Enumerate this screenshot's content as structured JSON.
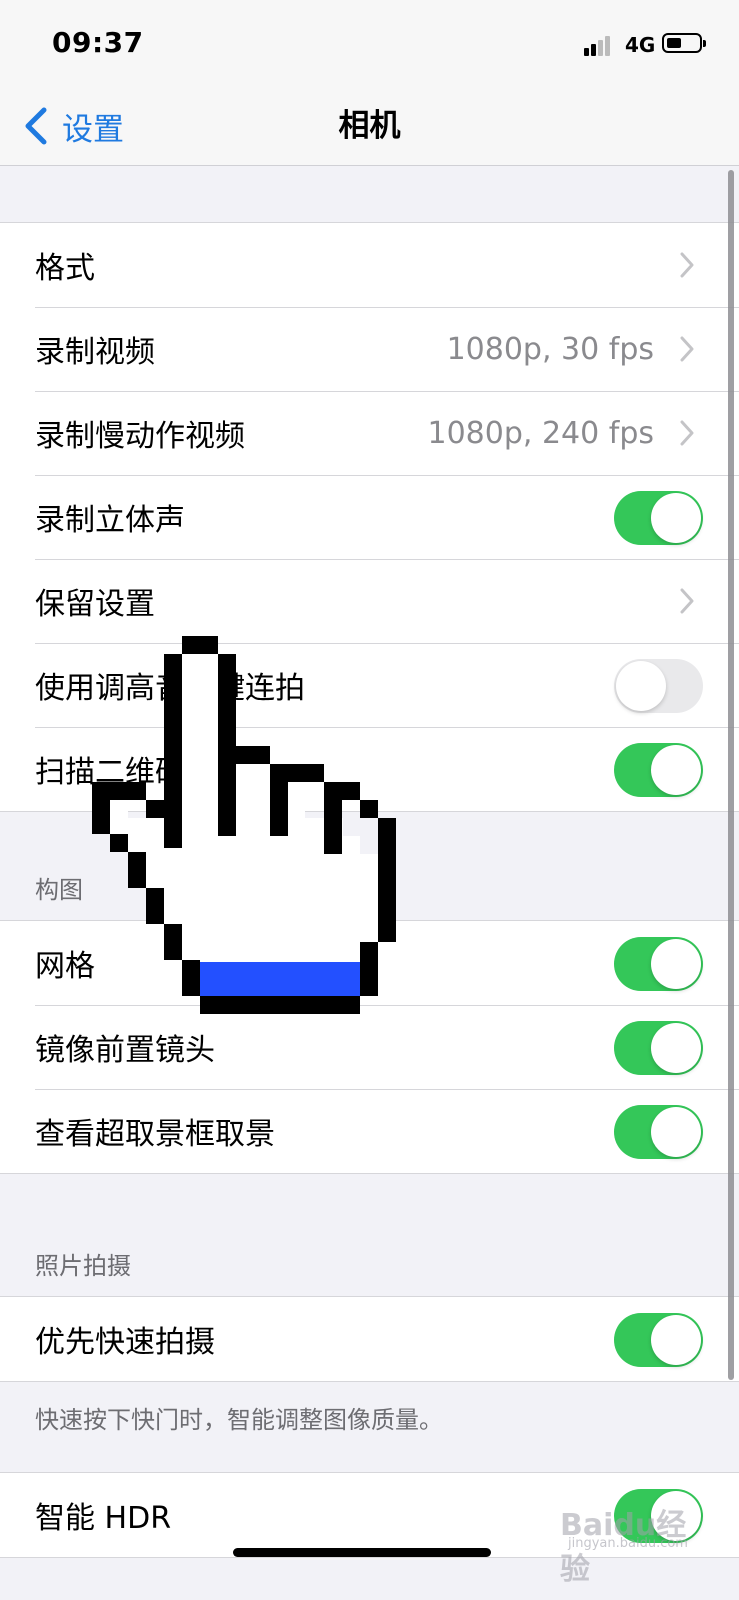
{
  "status_bar": {
    "time": "09:37",
    "network": "4G"
  },
  "nav": {
    "back_label": "设置",
    "title": "相机"
  },
  "group1": [
    {
      "label": "格式",
      "type": "link",
      "value": ""
    },
    {
      "label": "录制视频",
      "type": "link",
      "value": "1080p, 30 fps"
    },
    {
      "label": "录制慢动作视频",
      "type": "link",
      "value": "1080p, 240 fps"
    },
    {
      "label": "录制立体声",
      "type": "toggle",
      "on": true
    },
    {
      "label": "保留设置",
      "type": "link",
      "value": ""
    },
    {
      "label": "使用调高音量键连拍",
      "type": "toggle",
      "on": false
    },
    {
      "label": "扫描二维码",
      "type": "toggle",
      "on": true
    }
  ],
  "composition": {
    "header": "构图",
    "items": [
      {
        "label": "网格",
        "on": true
      },
      {
        "label": "镜像前置镜头",
        "on": true
      },
      {
        "label": "查看超取景框取景",
        "on": true
      }
    ]
  },
  "photo_capture": {
    "header": "照片拍摄",
    "items": [
      {
        "label": "优先快速拍摄",
        "on": true
      }
    ],
    "footer": "快速按下快门时，智能调整图像质量。"
  },
  "hdr": {
    "label": "智能 HDR",
    "on": true
  },
  "watermark": {
    "text": "Baidu经验",
    "sub": "jingyan.baidu.com"
  },
  "colors": {
    "accent": "#1f7ae0",
    "toggle_on": "#34c759",
    "toggle_off": "#e9e9eb",
    "cursor_band": "#2350ff"
  },
  "icons": {
    "back": "chevron-left-icon",
    "disclosure": "chevron-right-icon",
    "pointer": "hand-pointer-icon"
  }
}
